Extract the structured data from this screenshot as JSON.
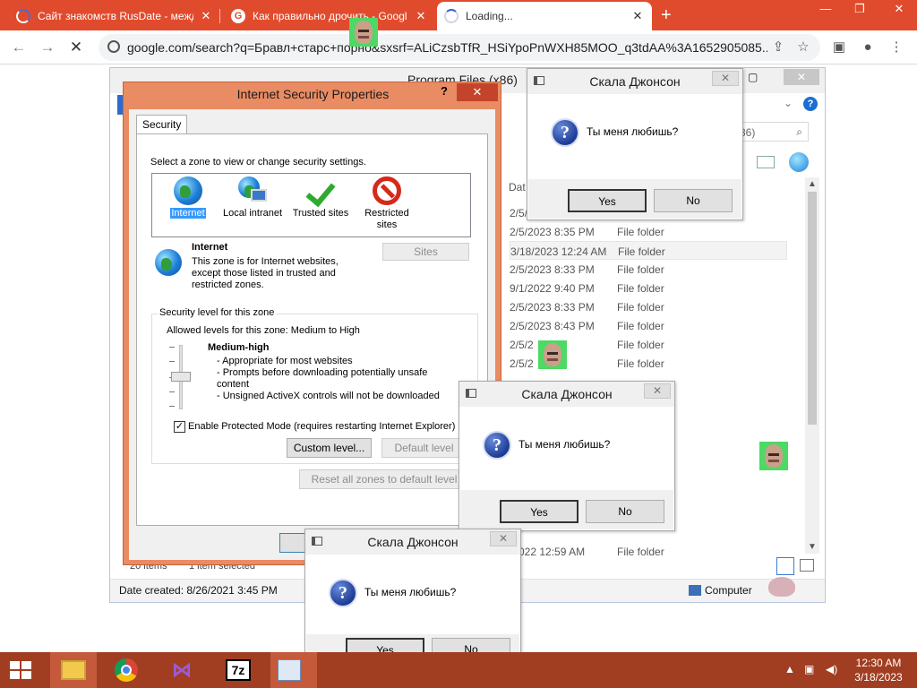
{
  "browser": {
    "tabs": [
      {
        "title": "Сайт знакомств RusDate - межд",
        "state": "loading"
      },
      {
        "title": "Как правильно дрочить - Googl",
        "state": "google"
      },
      {
        "title": "Loading...",
        "state": "loading-active"
      }
    ],
    "new_tab": "+",
    "window_controls": {
      "minimize": "—",
      "restore": "❐",
      "close": "✕"
    },
    "url": "google.com/search?q=Бравл+старс+порно&sxsrf=ALiCzsbTfR_HSiYpoPnWXH85MOO_q3tdAA%3A1652905085...",
    "nav": {
      "back": "←",
      "forward": "→",
      "stop": "✕"
    }
  },
  "explorer": {
    "title": "Program Files (x86)",
    "search_fragment": "36)",
    "column_date": "Dat",
    "rows": [
      {
        "date": "2/5/",
        "type": ""
      },
      {
        "date": "2/5/2023 8:35 PM",
        "type": "File folder"
      },
      {
        "date": "3/18/2023 12:24 AM",
        "type": "File folder",
        "selected": true
      },
      {
        "date": "2/5/2023 8:33 PM",
        "type": "File folder"
      },
      {
        "date": "9/1/2022 9:40 PM",
        "type": "File folder"
      },
      {
        "date": "2/5/2023 8:33 PM",
        "type": "File folder"
      },
      {
        "date": "2/5/2023 8:43 PM",
        "type": "File folder"
      },
      {
        "date": "2/5/2",
        "type": "File folder"
      },
      {
        "date": "2/5/2",
        "type": "File folder"
      }
    ],
    "rows_lower": [
      {
        "date": "/2022 12:59 AM",
        "type": "File folder"
      }
    ],
    "items_count": "20 items",
    "items_selected": "1 item selected",
    "date_created": "Date created: 8/26/2021 3:45 PM",
    "computer": "Computer"
  },
  "security_dialog": {
    "title": "Internet Security Properties",
    "help": "?",
    "close": "✕",
    "tab": "Security",
    "select_zone_label": "Select a zone to view or change security settings.",
    "zones": [
      {
        "name": "Internet",
        "icon": "internet-globe-icon",
        "selected": true
      },
      {
        "name": "Local intranet",
        "icon": "local-intranet-icon"
      },
      {
        "name": "Trusted sites",
        "icon": "trusted-sites-check-icon"
      },
      {
        "name": "Restricted\nsites",
        "icon": "restricted-sites-icon"
      }
    ],
    "zone_heading": "Internet",
    "zone_description": "This zone is for Internet websites,\nexcept those listed in trusted and\nrestricted zones.",
    "sites_button": "Sites",
    "level_group": "Security level for this zone",
    "allowed_levels": "Allowed levels for this zone: Medium to High",
    "level_name": "Medium-high",
    "level_points": [
      "- Appropriate for most websites",
      "- Prompts before downloading potentially unsafe content",
      "- Unsigned ActiveX controls will not be downloaded"
    ],
    "protected_mode": "Enable Protected Mode (requires restarting Internet Explorer)",
    "protected_mode_checked": true,
    "custom_level": "Custom level...",
    "default_level": "Default level",
    "reset_all": "Reset all zones to default level"
  },
  "message_box": {
    "title": "Скала Джонсон",
    "text": "Ты меня любишь?",
    "yes": "Yes",
    "no": "No",
    "close": "✕"
  },
  "taskbar": {
    "apps": [
      "start",
      "file-explorer",
      "chrome",
      "visual-studio",
      "7zip",
      "notepad"
    ],
    "time": "12:30 AM",
    "date": "3/18/2023"
  }
}
